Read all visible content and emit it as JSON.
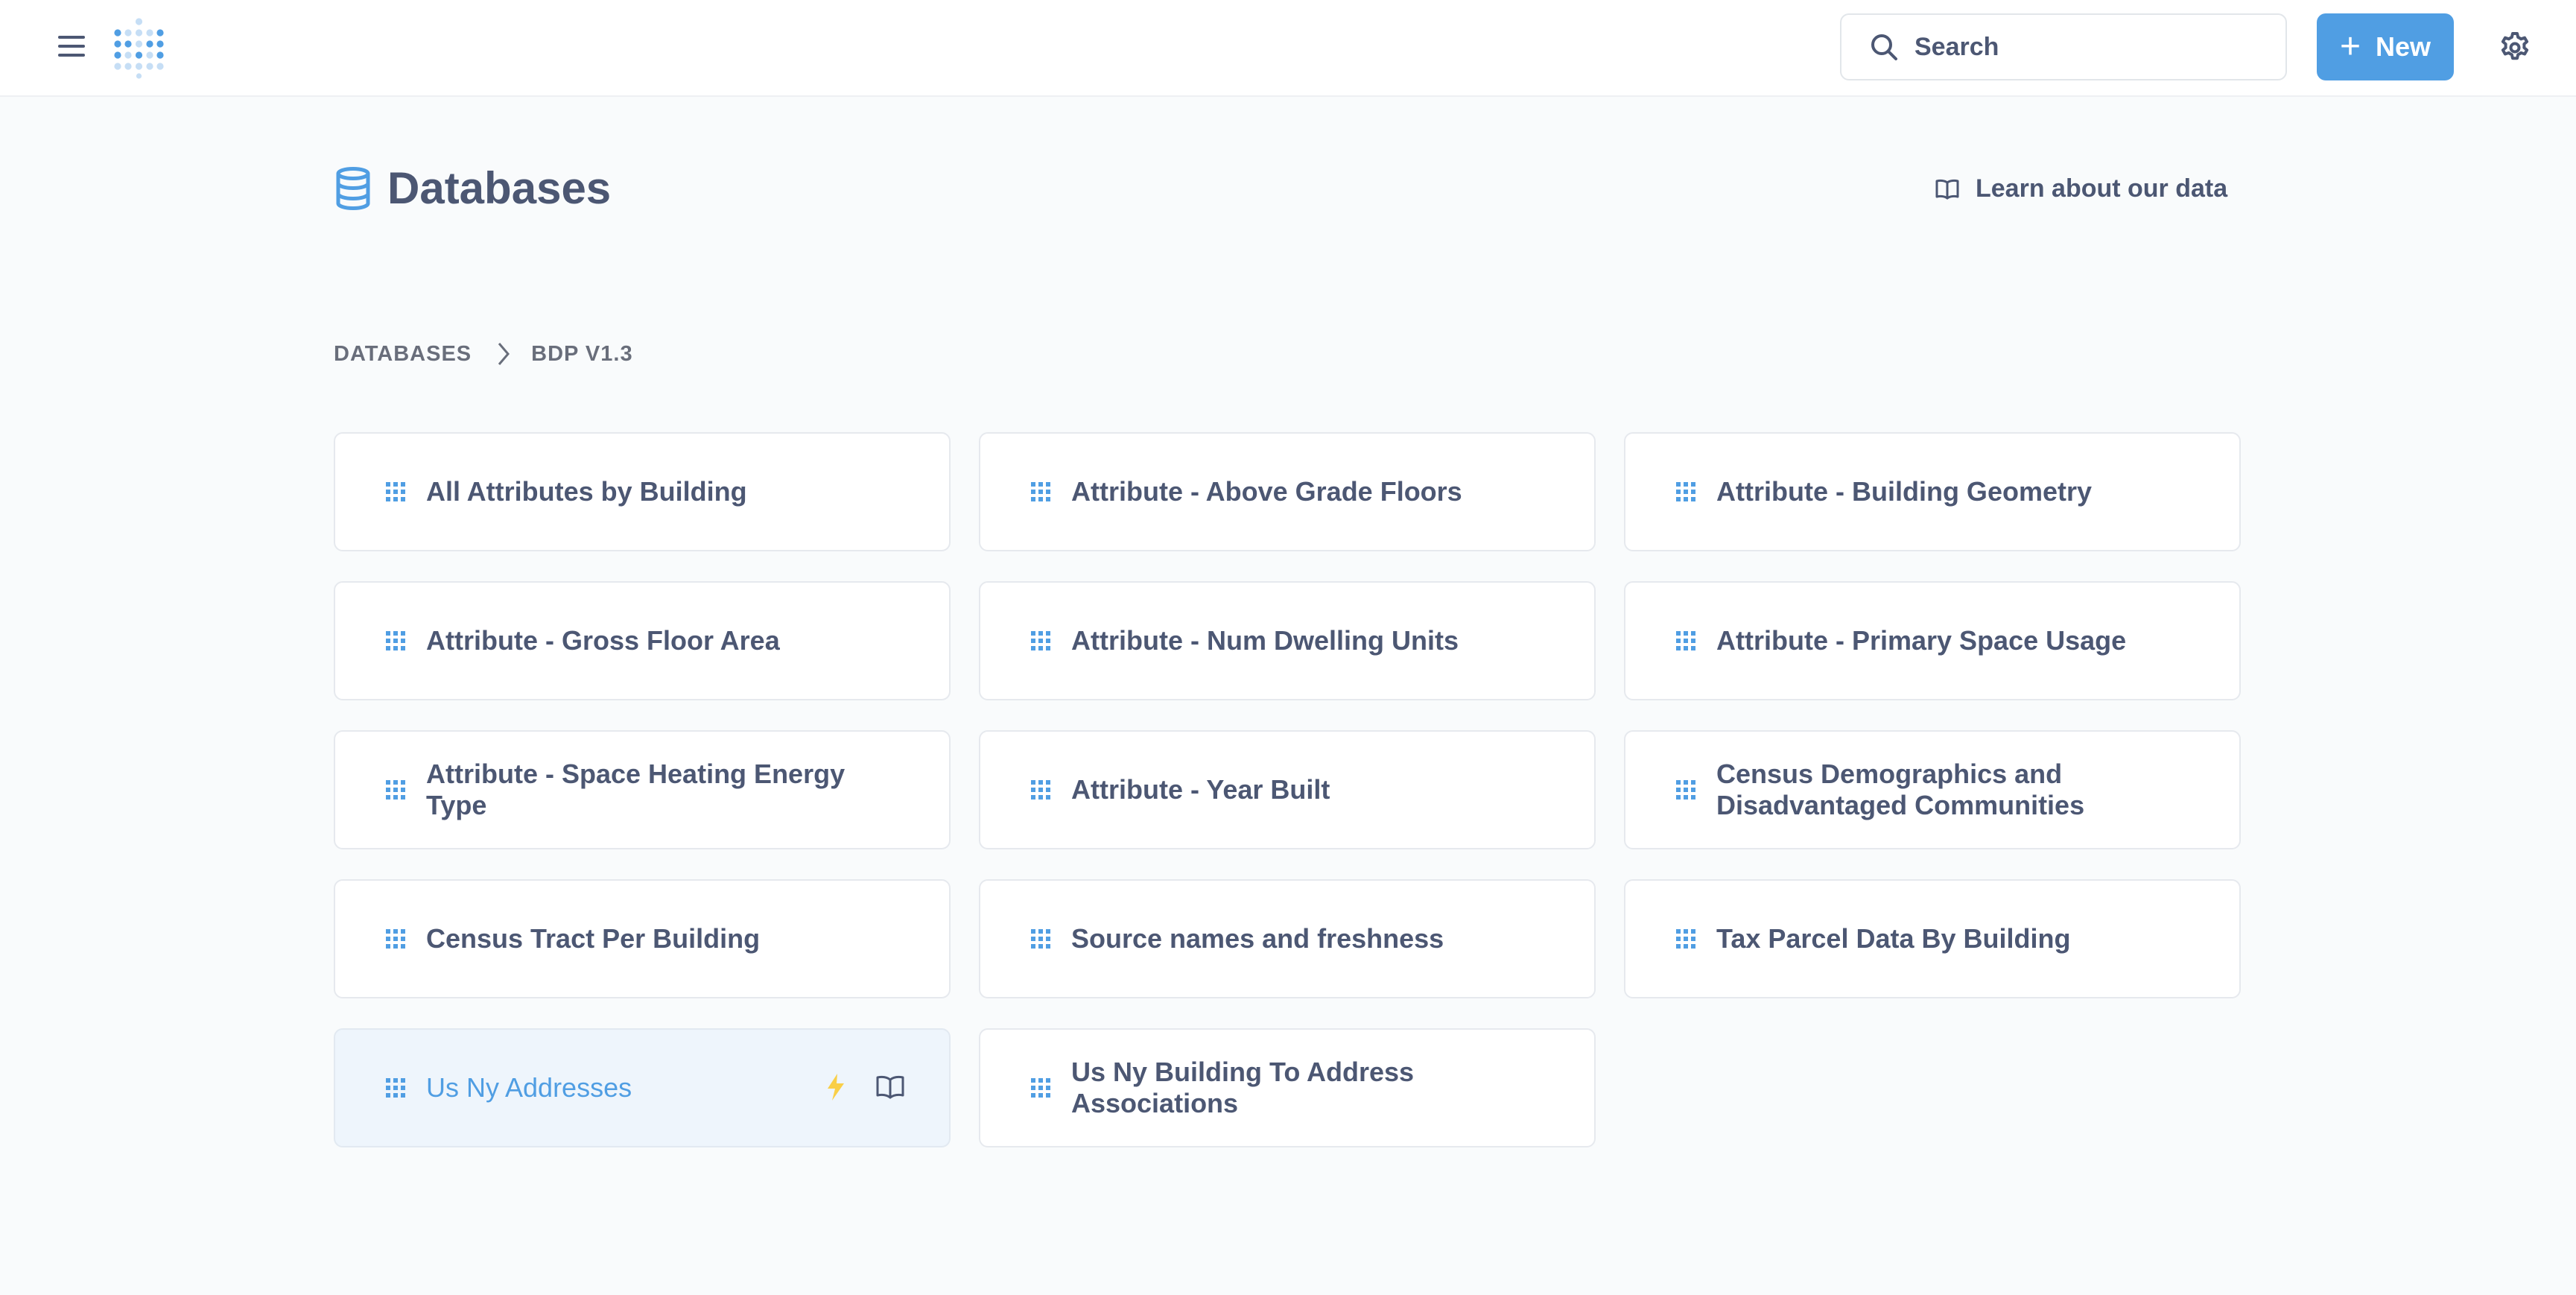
{
  "header": {
    "search_placeholder": "Search",
    "new_label": "New",
    "icons": {
      "menu": "hamburger-icon",
      "logo": "metabase-logo",
      "search": "search-icon",
      "new": "plus-icon",
      "settings": "gear-icon"
    }
  },
  "page": {
    "title": "Databases",
    "title_icon": "database-icon",
    "learn_label": "Learn about our data",
    "learn_icon": "book-icon"
  },
  "breadcrumb": {
    "items": [
      "DATABASES",
      "BDP V1.3"
    ],
    "separator_icon": "chevron-right-icon"
  },
  "tables": [
    {
      "name": "All Attributes by Building"
    },
    {
      "name": "Attribute - Above Grade Floors"
    },
    {
      "name": "Attribute - Building Geometry"
    },
    {
      "name": "Attribute - Gross Floor Area"
    },
    {
      "name": "Attribute - Num Dwelling Units"
    },
    {
      "name": "Attribute - Primary Space Usage"
    },
    {
      "name": "Attribute - Space Heating Energy Type"
    },
    {
      "name": "Attribute - Year Built"
    },
    {
      "name": "Census Demographics and Disadvantaged Communities"
    },
    {
      "name": "Census Tract Per Building"
    },
    {
      "name": "Source names and freshness"
    },
    {
      "name": "Tax Parcel Data By Building"
    },
    {
      "name": "Us Ny Addresses",
      "hovered": true,
      "action_icons": [
        "x-ray-bolt-icon",
        "book-icon"
      ]
    },
    {
      "name": "Us Ny Building To Address Associations"
    }
  ],
  "colors": {
    "brand": "#509ee3",
    "text": "#4c5773",
    "background": "#f9fbfc",
    "card_border": "#e6e9ee",
    "hover_bg": "#eef5fc",
    "bolt": "#f9cf48"
  }
}
